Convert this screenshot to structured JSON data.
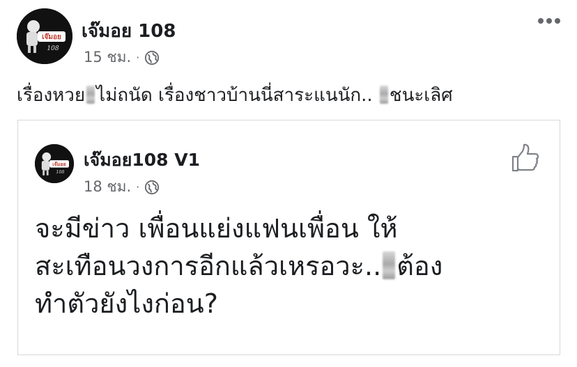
{
  "post": {
    "author": "เจ๊มอย 108",
    "time": "15 ชม.",
    "separator": "·",
    "privacy_icon": "globe-icon",
    "text_before": "เรื่องหวย",
    "text_middle": "ไม่ถนัด เรื่องชาวบ้านนี่สาระแนนัก..",
    "text_after": "ชนะเลิศ",
    "avatar_text": "เจ๊มอย",
    "avatar_number": "108"
  },
  "shared": {
    "author": "เจ๊มอย108 V1",
    "time": "18 ชม.",
    "separator": "·",
    "privacy_icon": "globe-icon",
    "line1": "จะมีข่าว เพื่อนแย่งแฟนเพื่อน ให้",
    "line2_before": "สะเทือนวงการอีกแล้วเหรอวะ..",
    "line2_after": "ต้อง",
    "line3": "ทำตัวยังไงก่อน?",
    "avatar_text": "เจ๊มอย",
    "avatar_number": "108"
  },
  "colors": {
    "text": "#1c1e21",
    "secondary": "#65676b",
    "border": "#d5d7db",
    "avatar_bg": "#111111",
    "avatar_text": "#c0392b"
  }
}
